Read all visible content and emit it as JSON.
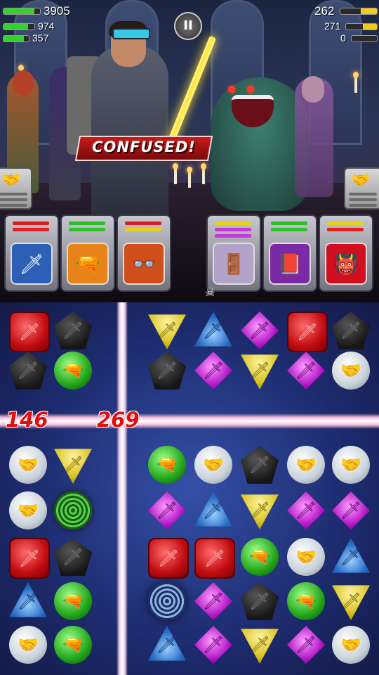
{
  "hud": {
    "player": {
      "health": "3905",
      "health_fill": 0.85,
      "shield": "974",
      "shield_fill": 0.8,
      "special": "357",
      "special_fill": 0.8
    },
    "enemy": {
      "health": "262",
      "health_fill": 0.45,
      "shield": "271",
      "shield_fill": 0.45,
      "special": "0",
      "special_fill": 0.0
    }
  },
  "pause_label": "II",
  "status_banner": "CONFUSED!",
  "damage_numbers": [
    "146",
    "269"
  ],
  "colors": {
    "health": "#35d12e",
    "enemy_health": "#f2cc19",
    "shield": "#35d12e",
    "special": "#35d12e",
    "banner": "#c91a1a",
    "damage": "#e50c0c"
  },
  "player_cards": [
    {
      "icon": "sword-icon",
      "color": "#2c5fb5",
      "bars": [
        "#e02020",
        "#e02020"
      ]
    },
    {
      "icon": "proton-gun-icon",
      "color": "#e8831a",
      "bars": [
        "#2fbf2a",
        "#2fbf2a"
      ]
    },
    {
      "icon": "glasses-icon",
      "color": "#d04f1a",
      "bars": [
        "#e02020",
        "#e9d21c"
      ]
    }
  ],
  "enemy_cards": [
    {
      "icon": "door-icon",
      "color": "#b4a3c8",
      "bars": [
        "#e9d21c",
        "#c43ad8",
        "#c43ad8"
      ]
    },
    {
      "icon": "book-icon",
      "color": "#7a2aa5",
      "bars": [
        "#2fbf2a",
        "#2fbf2a"
      ]
    },
    {
      "icon": "monster-icon",
      "color": "#d01020",
      "bars": [
        "#e9d21c",
        "#e02020"
      ]
    }
  ],
  "board": [
    [
      "red",
      "black",
      "",
      "yellow",
      "blue",
      "purple",
      "red",
      "black"
    ],
    [
      "black",
      "green",
      "",
      "black",
      "purple",
      "yellow",
      "purple",
      "white"
    ],
    [
      "",
      "",
      "",
      "",
      "",
      "",
      "",
      ""
    ],
    [
      "white",
      "yellow",
      "",
      "green",
      "white",
      "black",
      "white",
      "white"
    ],
    [
      "white",
      "green-swirl",
      "",
      "purple",
      "blue",
      "yellow",
      "purple",
      "purple"
    ],
    [
      "red",
      "black",
      "",
      "red",
      "red",
      "green",
      "white",
      "blue"
    ],
    [
      "blue",
      "green",
      "",
      "blue-swirl",
      "purple",
      "black",
      "green",
      "yellow"
    ],
    [
      "white",
      "green",
      "",
      "blue",
      "purple",
      "yellow",
      "purple",
      "white"
    ]
  ],
  "gem_icons": {
    "red": "sword-icon",
    "black": "sword-icon",
    "yellow": "sword-icon",
    "blue": "sword-icon",
    "purple": "sword-icon",
    "green": "proton-gun-icon",
    "white": "handshake-icon"
  }
}
